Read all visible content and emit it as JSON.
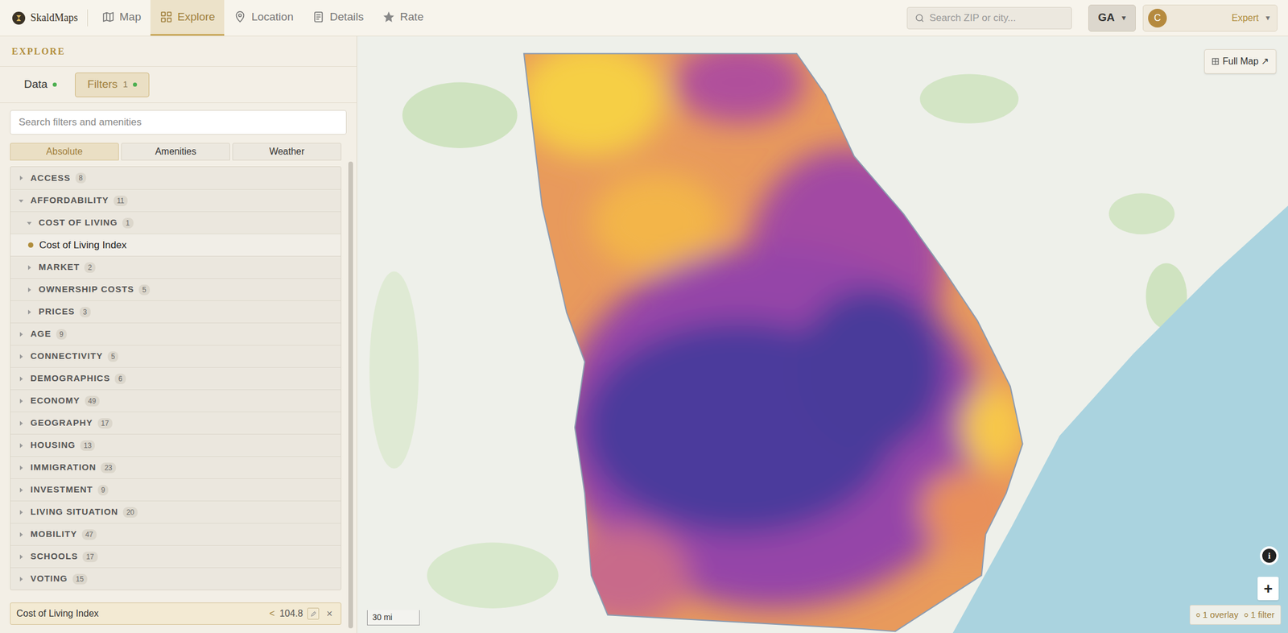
{
  "app": {
    "name": "SkaldMaps"
  },
  "nav": [
    {
      "label": "Map",
      "selected": false
    },
    {
      "label": "Explore",
      "selected": true
    },
    {
      "label": "Location",
      "selected": false
    },
    {
      "label": "Details",
      "selected": false
    },
    {
      "label": "Rate",
      "selected": false
    }
  ],
  "search": {
    "placeholder": "Search ZIP or city..."
  },
  "state_selector": {
    "value": "GA",
    "caret": "▾"
  },
  "user": {
    "initial": "C",
    "role": "Expert",
    "caret": "▾"
  },
  "sidebar": {
    "title": "EXPLORE",
    "tabs": [
      {
        "label": "Data",
        "badge": "",
        "selected": false
      },
      {
        "label": "Filters",
        "badge": "1",
        "selected": true
      }
    ],
    "search": {
      "placeholder": "Search filters and amenities"
    },
    "subtabs": [
      {
        "label": "Absolute",
        "selected": true
      },
      {
        "label": "Amenities",
        "selected": false
      },
      {
        "label": "Weather",
        "selected": false
      }
    ],
    "tree": [
      {
        "kind": "category",
        "label": "ACCESS",
        "count": "8",
        "expanded": false
      },
      {
        "kind": "category",
        "label": "AFFORDABILITY",
        "count": "11",
        "expanded": true
      },
      {
        "kind": "group",
        "label": "COST OF LIVING",
        "count": "1",
        "expanded": true
      },
      {
        "kind": "leaf",
        "label": "Cost of Living Index",
        "selected": true,
        "color": "#b08d3c"
      },
      {
        "kind": "group",
        "label": "MARKET",
        "count": "2",
        "expanded": false
      },
      {
        "kind": "group",
        "label": "OWNERSHIP COSTS",
        "count": "5",
        "expanded": false
      },
      {
        "kind": "group",
        "label": "PRICES",
        "count": "3",
        "expanded": false
      },
      {
        "kind": "category",
        "label": "AGE",
        "count": "9",
        "expanded": false
      },
      {
        "kind": "category",
        "label": "CONNECTIVITY",
        "count": "5",
        "expanded": false
      },
      {
        "kind": "category",
        "label": "DEMOGRAPHICS",
        "count": "6",
        "expanded": false
      },
      {
        "kind": "category",
        "label": "ECONOMY",
        "count": "49",
        "expanded": false
      },
      {
        "kind": "category",
        "label": "GEOGRAPHY",
        "count": "17",
        "expanded": false
      },
      {
        "kind": "category",
        "label": "HOUSING",
        "count": "13",
        "expanded": false
      },
      {
        "kind": "category",
        "label": "IMMIGRATION",
        "count": "23",
        "expanded": false
      },
      {
        "kind": "category",
        "label": "INVESTMENT",
        "count": "9",
        "expanded": false
      },
      {
        "kind": "category",
        "label": "LIVING SITUATION",
        "count": "20",
        "expanded": false
      },
      {
        "kind": "category",
        "label": "MOBILITY",
        "count": "47",
        "expanded": false
      },
      {
        "kind": "category",
        "label": "SCHOOLS",
        "count": "17",
        "expanded": false
      },
      {
        "kind": "category",
        "label": "VOTING",
        "count": "15",
        "expanded": false
      }
    ],
    "active_filter": {
      "label": "Cost of Living Index",
      "operator": "<",
      "value": "104.8",
      "remove": "×"
    }
  },
  "map": {
    "full_map": "Full Map ↗",
    "scale": "30 mi",
    "zoom_in": "+",
    "info": "i",
    "status": {
      "overlays": "1 overlay",
      "filters": "1 filter"
    }
  }
}
